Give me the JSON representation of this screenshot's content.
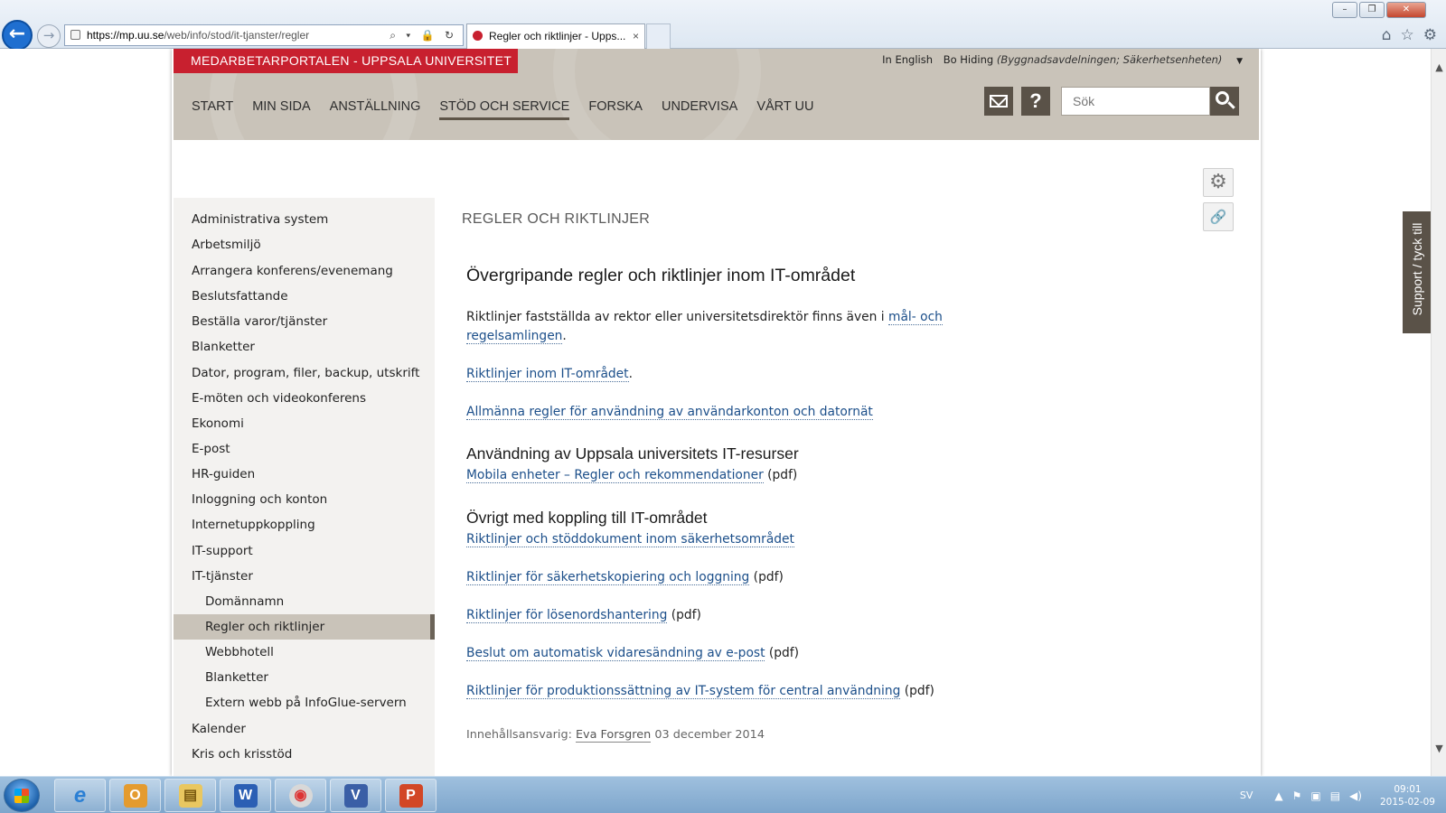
{
  "browser": {
    "url_host": "https://mp.uu.se",
    "url_path": "/web/info/stod/it-tjanster/regler",
    "tab_title": "Regler och riktlinjer - Upps...",
    "addr_tools": "⌕ ▾ 🔒 ↻",
    "tab_close": "×"
  },
  "header": {
    "portal_title": "MEDARBETARPORTALEN - UPPSALA UNIVERSITET",
    "lang_link": "In English",
    "user_name": "Bo Hiding",
    "user_org": "(Byggnadsavdelningen; Säkerhetsenheten)",
    "search_placeholder": "Sök",
    "help_symbol": "?",
    "nav": [
      {
        "label": "START"
      },
      {
        "label": "MIN SIDA"
      },
      {
        "label": "ANSTÄLLNING"
      },
      {
        "label": "STÖD OCH SERVICE"
      },
      {
        "label": "FORSKA"
      },
      {
        "label": "UNDERVISA"
      },
      {
        "label": "VÅRT UU"
      }
    ]
  },
  "sidebar": {
    "items": [
      {
        "label": "Administrativa system"
      },
      {
        "label": "Arbetsmiljö"
      },
      {
        "label": "Arrangera konferens/evenemang"
      },
      {
        "label": "Beslutsfattande"
      },
      {
        "label": "Beställa varor/tjänster"
      },
      {
        "label": "Blanketter"
      },
      {
        "label": "Dator, program, filer, backup, utskrift"
      },
      {
        "label": "E-möten och videokonferens"
      },
      {
        "label": "Ekonomi"
      },
      {
        "label": "E-post"
      },
      {
        "label": "HR-guiden"
      },
      {
        "label": "Inloggning och konton"
      },
      {
        "label": "Internetuppkoppling"
      },
      {
        "label": "IT-support"
      },
      {
        "label": "IT-tjänster"
      },
      {
        "label": "Domännamn"
      },
      {
        "label": "Regler och riktlinjer"
      },
      {
        "label": "Webbhotell"
      },
      {
        "label": "Blanketter"
      },
      {
        "label": "Extern webb på InfoGlue-servern"
      },
      {
        "label": "Kalender"
      },
      {
        "label": "Kris och krisstöd"
      }
    ]
  },
  "content": {
    "section_heading": "REGLER OCH RIKTLINJER",
    "h_main": "Övergripande regler och riktlinjer inom IT-området",
    "intro_text": "Riktlinjer fastställda av rektor eller universitetsdirektör finns även i ",
    "intro_link_1": "mål- och",
    "intro_link_2": "regelsamlingen",
    "period": ".",
    "link_it_guidelines": "Riktlinjer inom IT-området",
    "link_general_rules": "Allmänna regler för användning av användarkonton och datornät",
    "h_usage": "Användning av Uppsala universitets IT-resurser",
    "link_mobile": "Mobila enheter – Regler och rekommendationer",
    "h_other": "Övrigt med koppling till IT-området",
    "link_security_docs": "Riktlinjer och stöddokument inom säkerhetsområdet",
    "link_backup": "Riktlinjer för säkerhetskopiering och loggning",
    "link_passwords": "Riktlinjer för lösenordshantering",
    "link_forwarding": "Beslut om automatisk vidaresändning av e-post",
    "link_production": "Riktlinjer för produktionssättning av IT-system för central användning",
    "pdf": " (pdf)",
    "meta_label": "Innehållsansvarig: ",
    "meta_person": "Eva Forsgren",
    "meta_date": " 03 december 2014"
  },
  "tools": {
    "gear_glyph": "⚙",
    "link_glyph": "🔗"
  },
  "support_tab": "Support / tyck till",
  "taskbar": {
    "apps": [
      {
        "name": "internet-explorer",
        "glyph": "e"
      },
      {
        "name": "outlook",
        "glyph": "O"
      },
      {
        "name": "explorer",
        "glyph": "▤"
      },
      {
        "name": "word",
        "glyph": "W"
      },
      {
        "name": "chrome",
        "glyph": "◉"
      },
      {
        "name": "visio",
        "glyph": "V"
      },
      {
        "name": "powerpoint",
        "glyph": "P"
      }
    ],
    "language": "SV",
    "time": "09:01",
    "date": "2015-02-09"
  },
  "colors": {
    "brand_red": "#c8202f",
    "header_bg": "#c9c3b9",
    "dark_accent": "#5a5248",
    "link": "#1c4f8a"
  }
}
